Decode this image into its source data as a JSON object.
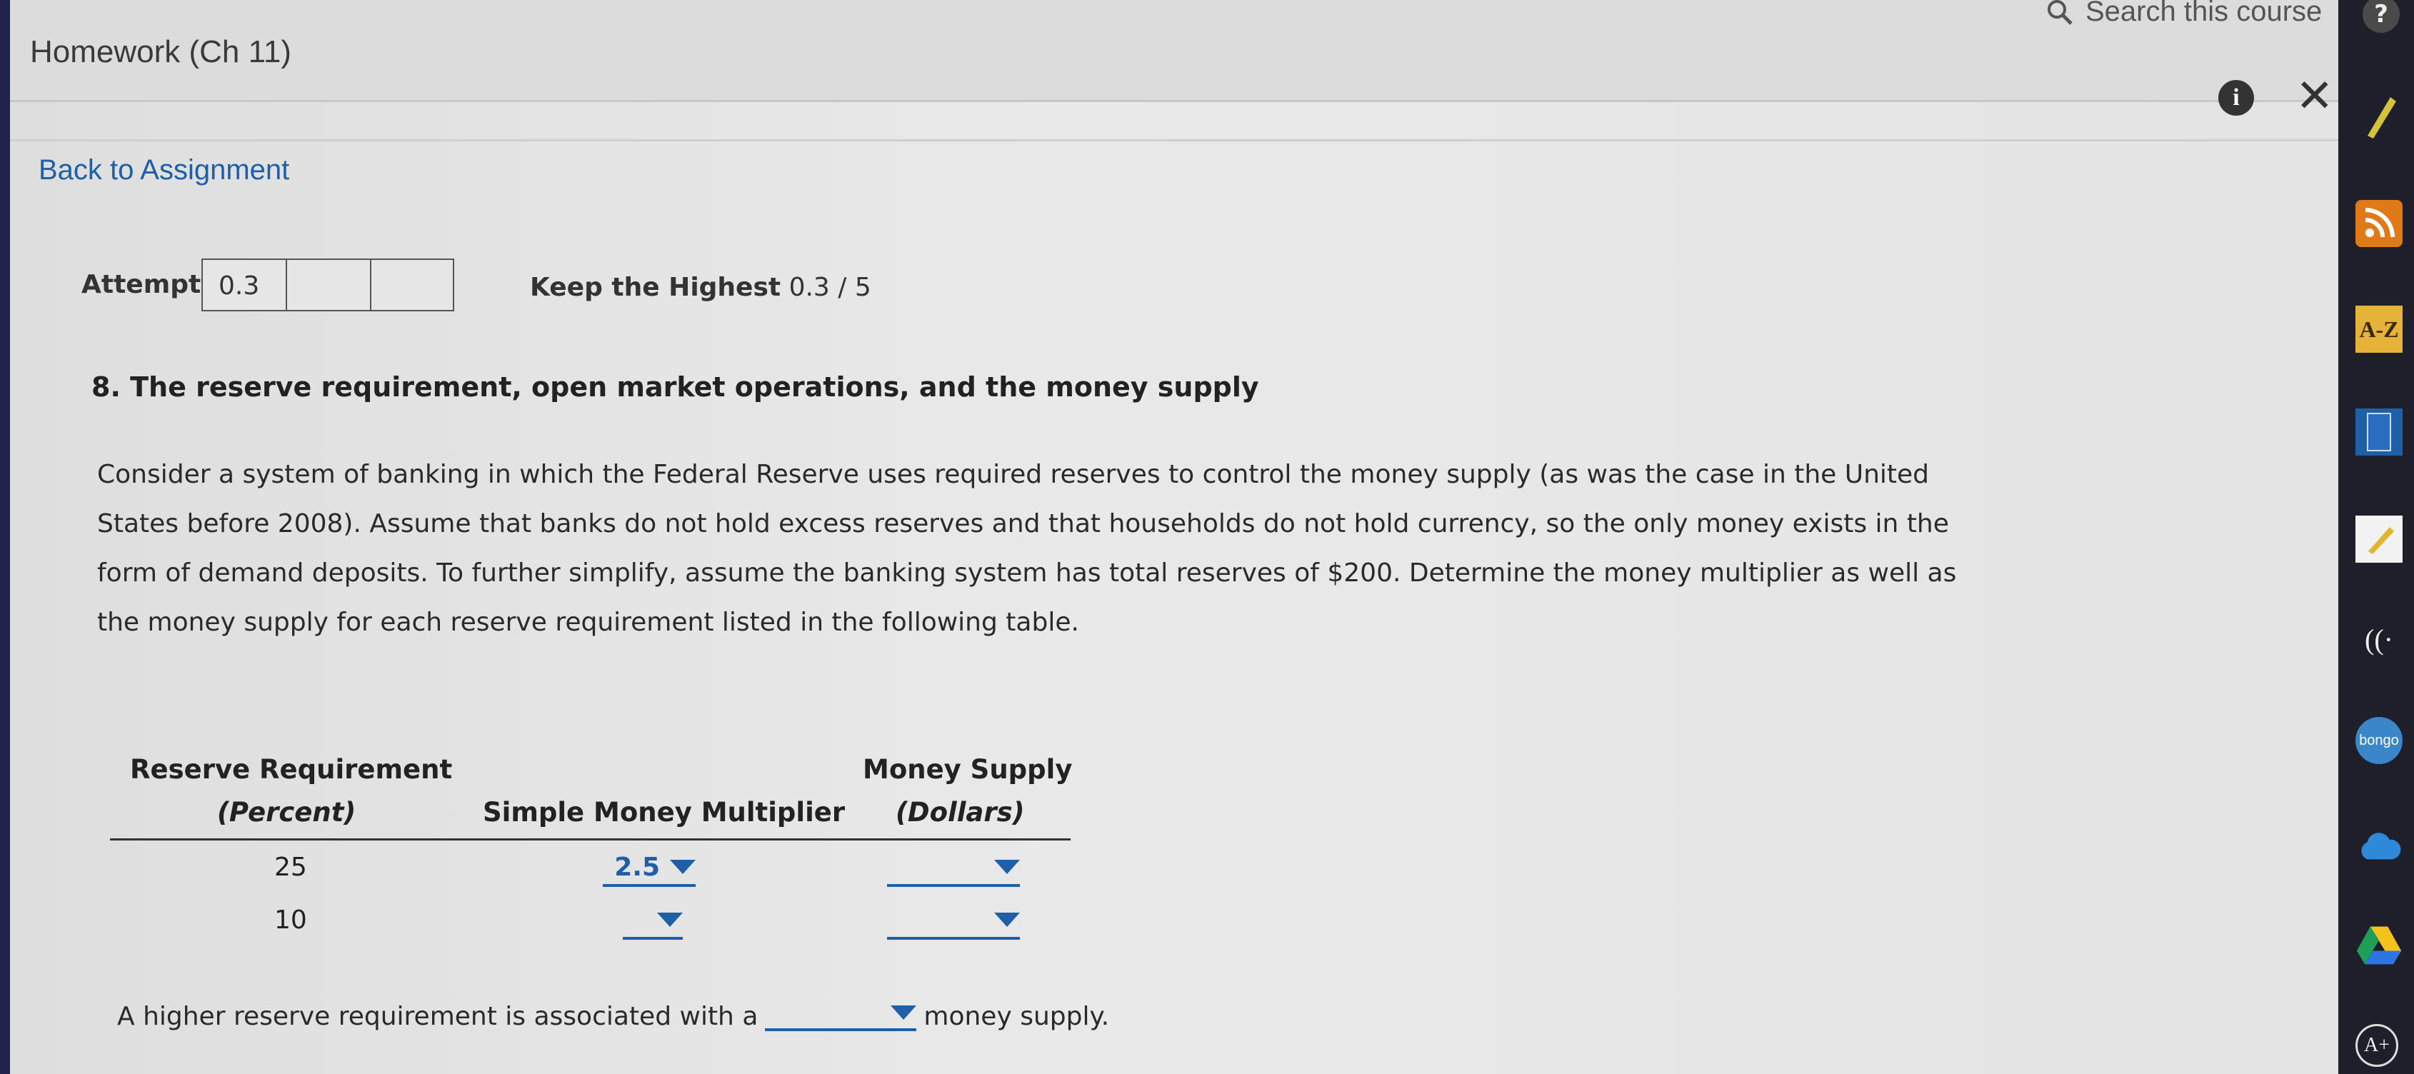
{
  "header": {
    "title": "Homework (Ch 11)",
    "search_placeholder": "Search this course"
  },
  "nav": {
    "back_label": "Back to Assignment"
  },
  "attempts": {
    "label": "Attempts",
    "values": [
      "0.3",
      "",
      ""
    ],
    "keep_label": "Keep the Highest",
    "keep_value": "0.3 / 5"
  },
  "question": {
    "title": "8. The reserve requirement, open market operations, and the money supply",
    "body": "Consider a system of banking in which the Federal Reserve uses required reserves to control the money supply (as was the case in the United States before 2008). Assume that banks do not hold excess reserves and that households do not hold currency, so the only money exists in the form of demand deposits. To further simplify, assume the banking system has total reserves of $200. Determine the money multiplier as well as the money supply for each reserve requirement listed in the following table."
  },
  "table": {
    "col1_line1": "Reserve Requirement",
    "col1_line2": "(Percent)",
    "col2": "Simple Money Multiplier",
    "col3_line1": "Money Supply",
    "col3_line2": "(Dollars)",
    "rows": [
      {
        "reserve": "25",
        "multiplier": "2.5",
        "money_supply": ""
      },
      {
        "reserve": "10",
        "multiplier": "",
        "money_supply": ""
      }
    ]
  },
  "conclusion": {
    "before": "A higher reserve requirement is associated with a",
    "selected": "",
    "after": "money supply."
  },
  "colors": {
    "accent": "#1f5fa8",
    "dock": "#1e1f2a"
  },
  "dock": {
    "help": "?",
    "az": "A-Z",
    "bongo": "bongo"
  }
}
